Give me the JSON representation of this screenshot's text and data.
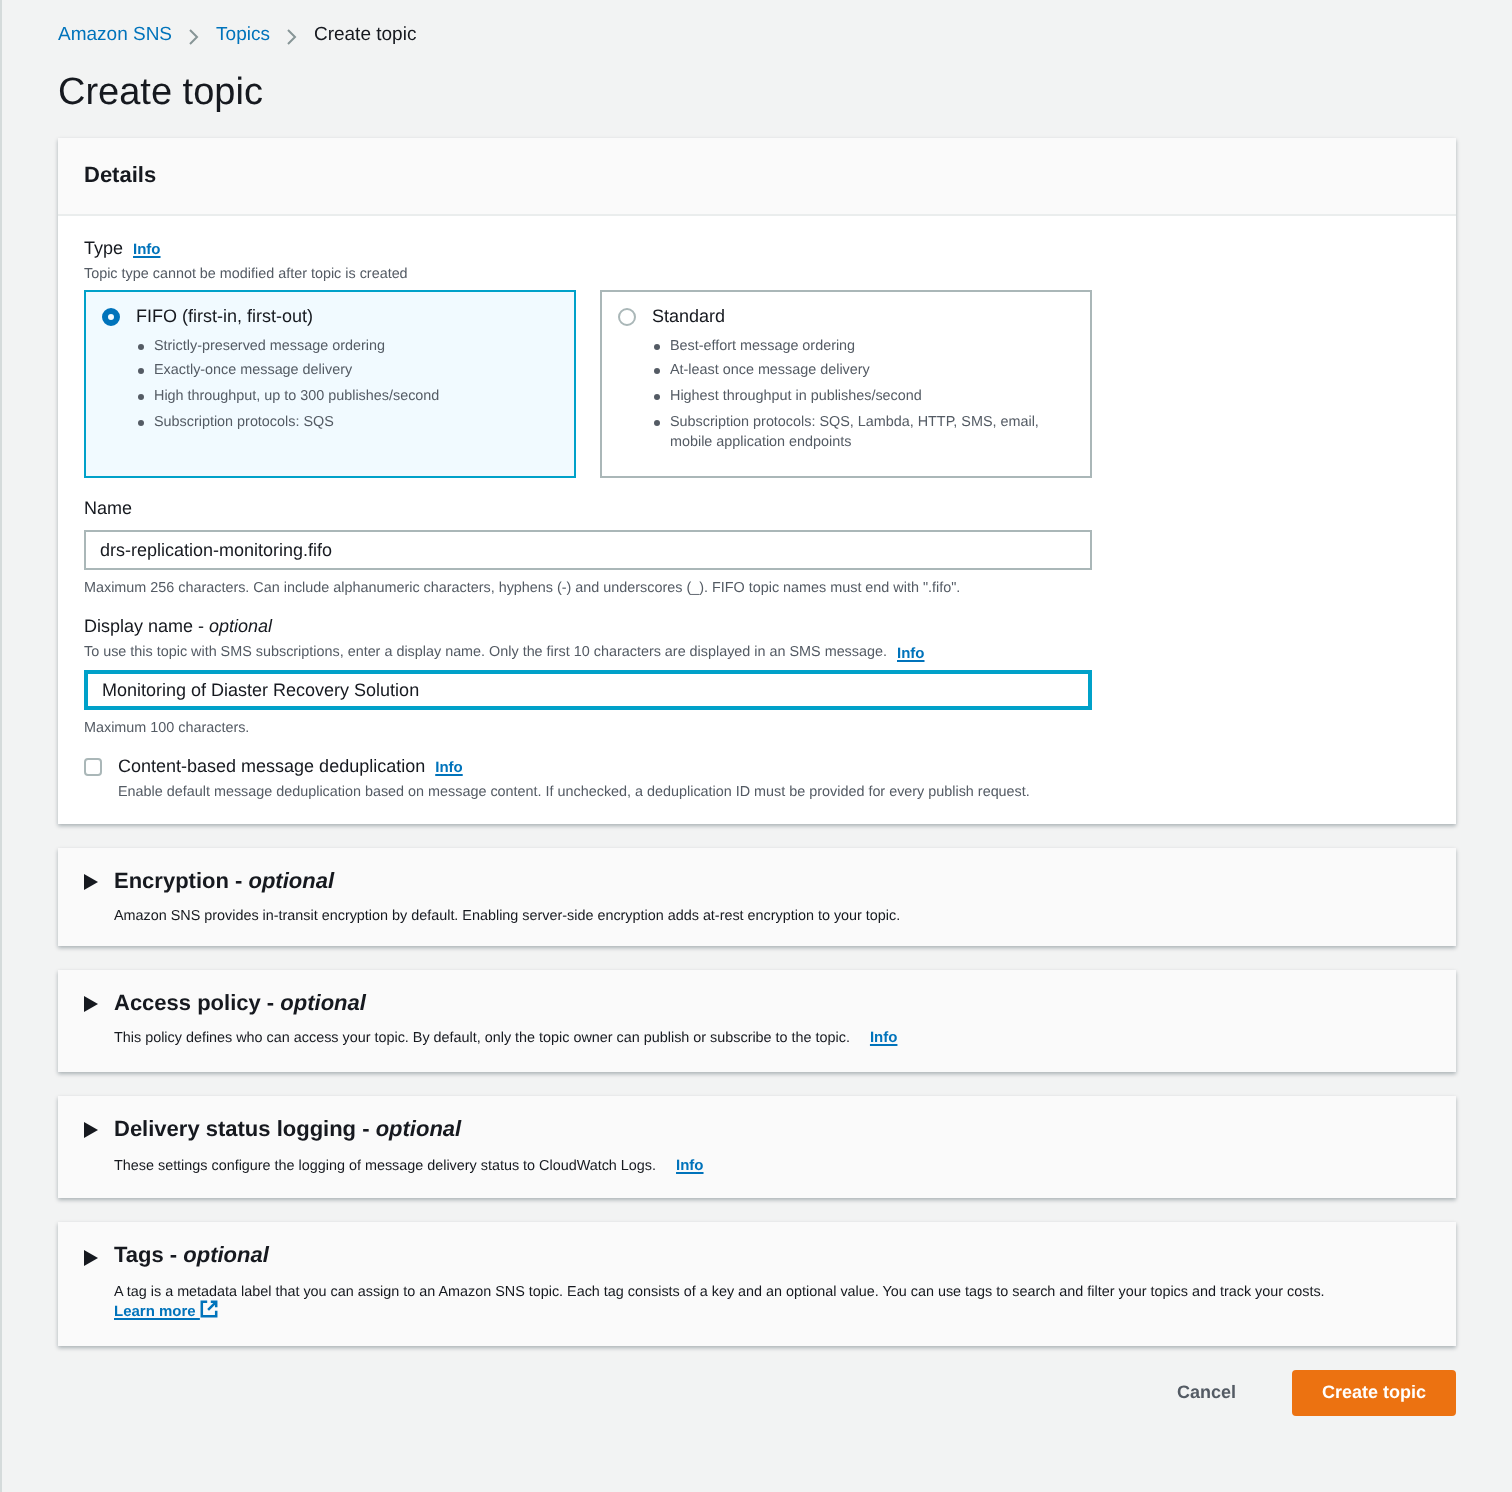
{
  "breadcrumbs": [
    {
      "label": "Amazon SNS",
      "kind": "link"
    },
    {
      "label": "Topics",
      "kind": "link"
    },
    {
      "label": "Create topic",
      "kind": "current"
    }
  ],
  "title": "Create topic",
  "details": {
    "title": "Details",
    "type": {
      "label": "Type",
      "info": "Info",
      "hint": "Topic type cannot be modified after topic is created",
      "options": [
        {
          "label": "FIFO (first-in, first-out)",
          "selected": true,
          "features": [
            "Strictly-preserved message ordering",
            "Exactly-once message delivery",
            "High throughput, up to 300 publishes/second",
            "Subscription protocols: SQS"
          ]
        },
        {
          "label": "Standard",
          "selected": false,
          "features": [
            "Best-effort message ordering",
            "At-least once message delivery",
            "Highest throughput in publishes/second",
            "Subscription protocols: SQS, Lambda, HTTP, SMS, email, mobile application endpoints"
          ]
        }
      ]
    },
    "name": {
      "label": "Name",
      "value": "drs-replication-monitoring.fifo",
      "focused": false,
      "hint": "Maximum 256 characters. Can include alphanumeric characters, hyphens (-) and underscores (_). FIFO topic names must end with \".fifo\"."
    },
    "display_name": {
      "label": "Display name - *optional*",
      "description": "To use this topic with SMS subscriptions, enter a display name. Only the first 10 characters are displayed in an SMS message.",
      "info": "Info",
      "value": "Monitoring of Diaster Recovery Solution",
      "focused": true,
      "hint": "Maximum 100 characters."
    },
    "deduplication": {
      "label": "Content-based message deduplication",
      "info": "Info",
      "checked": false,
      "description": "Enable default message deduplication based on message content. If unchecked, a deduplication ID must be provided for every publish request."
    }
  },
  "sections": [
    {
      "title": "Encryption - *optional*",
      "expanded": false,
      "description": "Amazon SNS provides in-transit encryption by default. Enabling server-side encryption adds at-rest encryption to your topic."
    },
    {
      "title": "Access policy - *optional*",
      "expanded": false,
      "description": "This policy defines who can access your topic. By default, only the topic owner can publish or subscribe to the topic.",
      "info": "Info"
    },
    {
      "title": "Delivery status logging - *optional*",
      "expanded": false,
      "description": "These settings configure the logging of message delivery status to CloudWatch Logs.",
      "info": "Info"
    },
    {
      "title": "Tags - *optional*",
      "expanded": false,
      "description": "A tag is a metadata label that you can assign to an Amazon SNS topic. Each tag consists of a key and an optional value. You can use tags to search and filter your topics and track your costs.",
      "link": "Learn more"
    }
  ],
  "buttons": [
    {
      "label": "Cancel",
      "kind": "link"
    },
    {
      "label": "Create topic",
      "kind": "primary"
    }
  ]
}
